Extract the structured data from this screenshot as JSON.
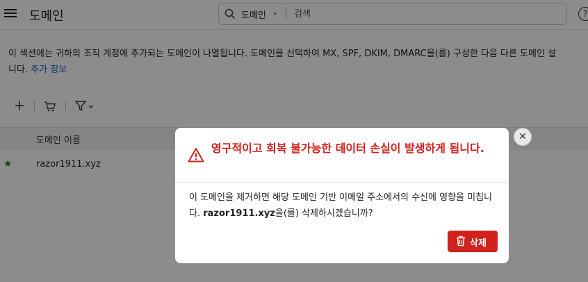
{
  "header": {
    "title": "도메인",
    "search": {
      "scope": "도메인",
      "placeholder": "검색"
    },
    "help_glyph": "?"
  },
  "description": {
    "text": "이 섹션에는 귀하의 조직 계정에 추가되는 도메인이 나열됩니다. 도메인을 선택하여 MX, SPF, DKIM, DMARC을(를) 구성한 다음 다른 도메인 설",
    "text2": "니다.",
    "link": "추가 정보"
  },
  "table": {
    "column_name": "도메인 이름",
    "rows": [
      {
        "domain": "razor1911.xyz",
        "starred": true
      }
    ]
  },
  "modal": {
    "title": "영구적이고 회복 불가능한 데이터 손실이 발생하게 됩니다.",
    "body_pre": "이 도메인을 제거하면 해당 도메인 기반 이메일 주소에서의 수신에 영향을 미칩니다. ",
    "body_domain": "razor1911.xyz",
    "body_post": "을(를) 삭제하시겠습니까?",
    "delete_label": "삭제",
    "close_glyph": "✕"
  },
  "colors": {
    "danger": "#d1221d",
    "link": "#1a5fb4",
    "star": "#2a7a2a"
  }
}
